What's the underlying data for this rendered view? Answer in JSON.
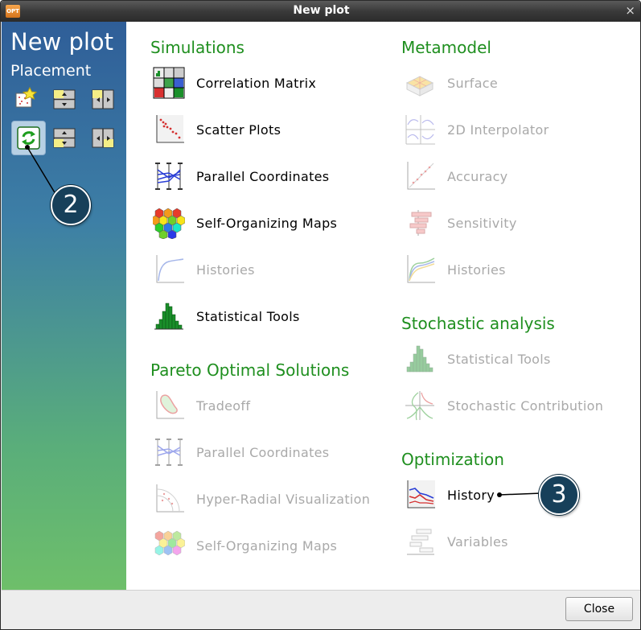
{
  "window": {
    "title": "New plot",
    "app_icon_text": "OPT",
    "close_symbol": "×"
  },
  "sidebar": {
    "title": "New plot",
    "subtitle": "Placement"
  },
  "sections": {
    "simulations": "Simulations",
    "pareto": "Pareto Optimal Solutions",
    "metamodel": "Metamodel",
    "stochastic": "Stochastic analysis",
    "optimization": "Optimization"
  },
  "simulations": [
    "Correlation Matrix",
    "Scatter Plots",
    "Parallel Coordinates",
    "Self-Organizing Maps",
    "Histories",
    "Statistical Tools"
  ],
  "pareto": [
    "Tradeoff",
    "Parallel Coordinates",
    "Hyper-Radial Visualization",
    "Self-Organizing Maps"
  ],
  "metamodel": [
    "Surface",
    "2D Interpolator",
    "Accuracy",
    "Sensitivity",
    "Histories"
  ],
  "stochastic": [
    "Statistical Tools",
    "Stochastic Contribution"
  ],
  "optimization": [
    "History",
    "Variables"
  ],
  "footer": {
    "close_label": "Close"
  },
  "callouts": {
    "step2": "2",
    "step3": "3"
  },
  "colors": {
    "section_title": "#1f8f1f",
    "disabled_text": "#a9a9a9",
    "callout_bg": "#17405a"
  }
}
